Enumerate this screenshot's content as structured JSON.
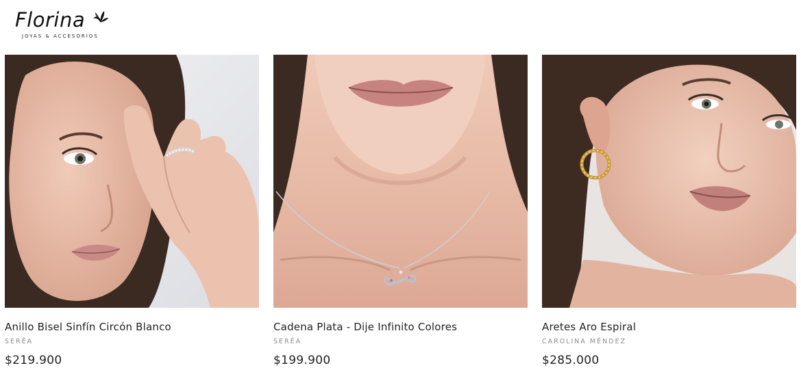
{
  "store": {
    "logo_word": "Florina",
    "logo_tagline": "JOYAS & ACCESORIOS",
    "logo_icon": "leaf-icon"
  },
  "colors": {
    "skin": "#e9c3b0",
    "hair": "#3a2a22",
    "lips": "#c98a86",
    "background": "#ffffff",
    "muted_text": "#8a8a8a"
  },
  "products": [
    {
      "name": "Anillo Bisel Sinfín Circón Blanco",
      "brand": "SERÉA",
      "price": "$219.900",
      "image": "model-with-ring-photo"
    },
    {
      "name": "Cadena Plata - Dije Infinito Colores",
      "brand": "SERÉA",
      "price": "$199.900",
      "image": "model-with-necklace-photo"
    },
    {
      "name": "Aretes Aro Espiral",
      "brand": "CAROLINA MÉNDEZ",
      "price": "$285.000",
      "image": "model-with-hoop-earring-photo"
    }
  ]
}
